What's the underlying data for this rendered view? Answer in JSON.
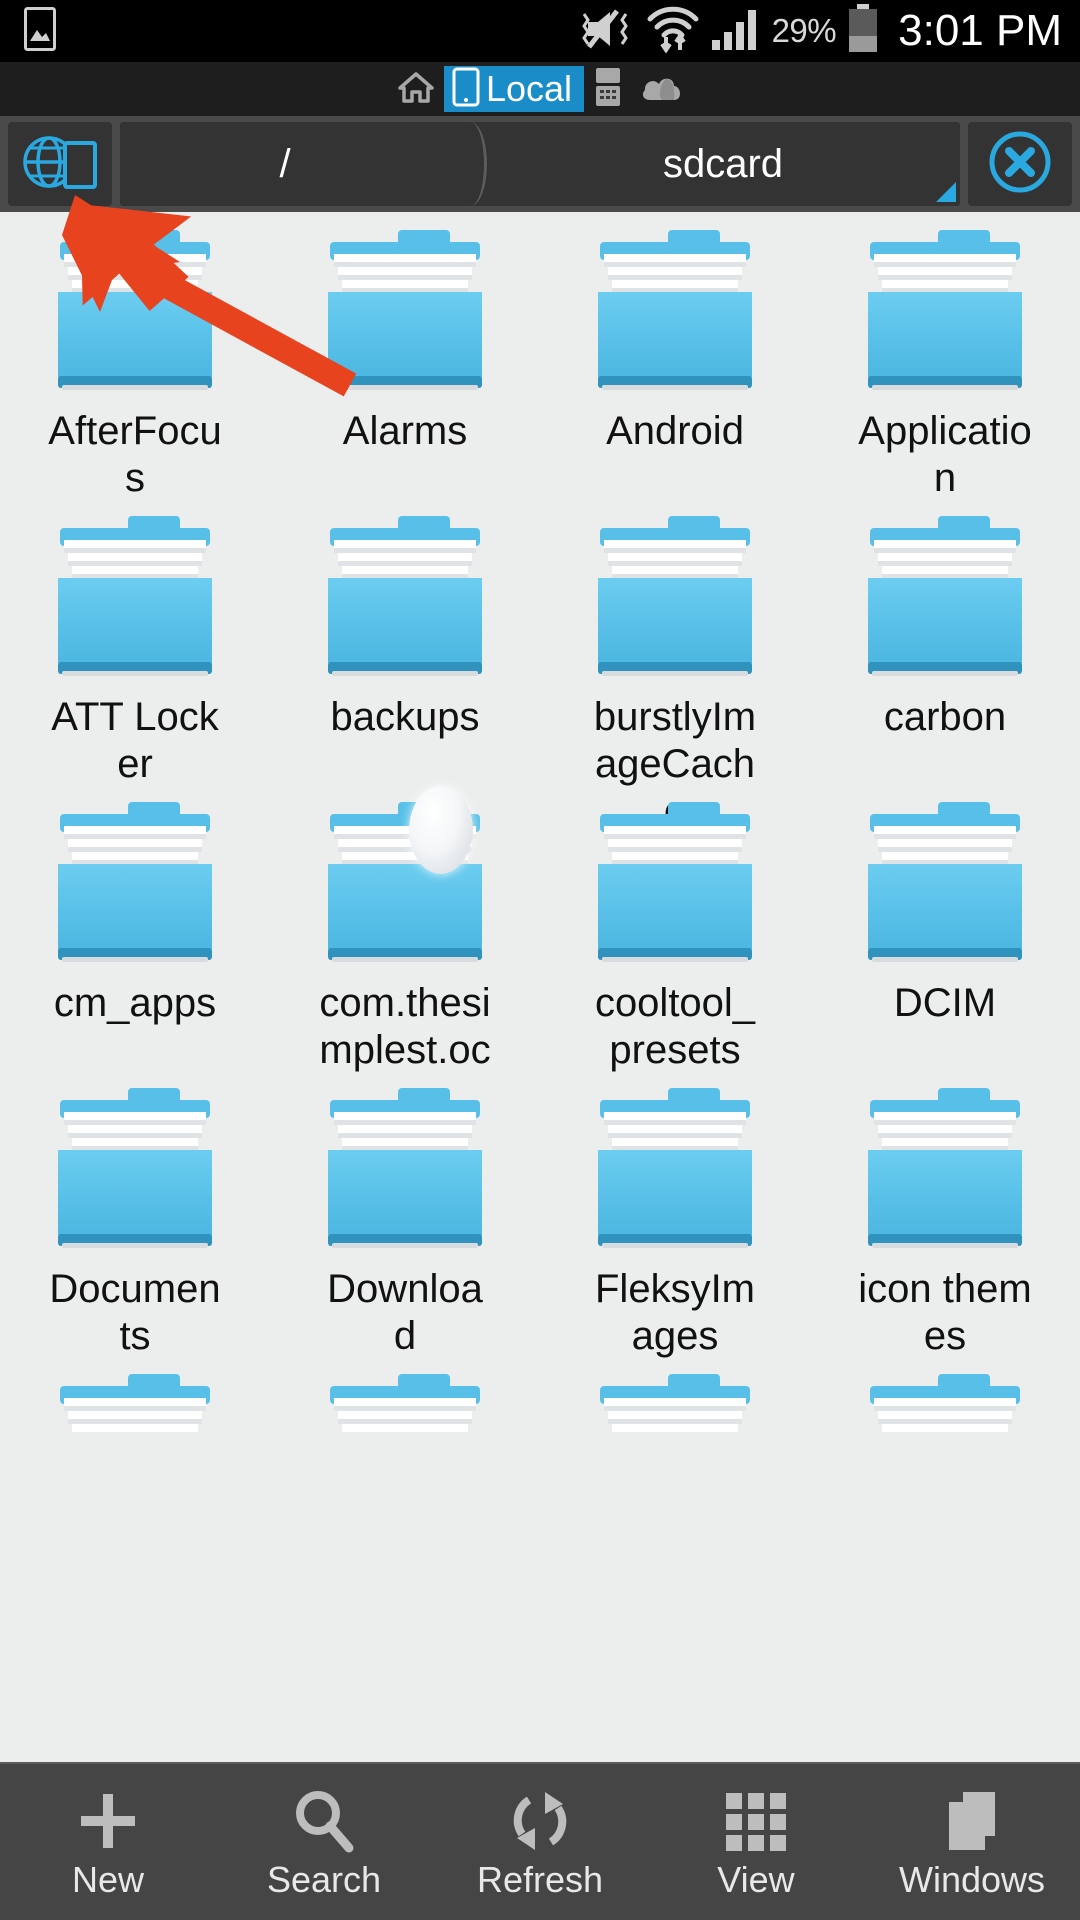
{
  "status_bar": {
    "left_icons": [
      {
        "name": "gallery-image-icon",
        "glyph": "image"
      }
    ],
    "right_icons": [
      {
        "name": "vibrate-mute-icon",
        "glyph": "mute-vibrate"
      },
      {
        "name": "wifi-data-icon",
        "glyph": "wifi"
      },
      {
        "name": "cellular-signal-icon",
        "glyph": "signal"
      }
    ],
    "battery_percent": "29%",
    "clock": "3:01 PM"
  },
  "tab_bar": {
    "tabs": [
      {
        "label": "",
        "icon": "home-icon",
        "active": false
      },
      {
        "label": "Local",
        "icon": "phone-icon",
        "active": true
      },
      {
        "label": "",
        "icon": "flip-phone-icon",
        "active": false
      },
      {
        "label": "",
        "icon": "cloud-icon",
        "active": false
      }
    ],
    "active_accent": "#1a8cc8"
  },
  "path_bar": {
    "network_button": {
      "name": "network-device-button",
      "icon": "globe-device-icon"
    },
    "crumbs": [
      {
        "label": "/",
        "name": "breadcrumb-root"
      },
      {
        "label": "sdcard",
        "name": "breadcrumb-sdcard"
      }
    ],
    "close_button": {
      "name": "close-tab-button",
      "icon": "close-circle-icon"
    },
    "accent": "#2aa8e0"
  },
  "file_grid": {
    "items": [
      {
        "name": "AfterFocus",
        "type": "folder"
      },
      {
        "name": "Alarms",
        "type": "folder"
      },
      {
        "name": "Android",
        "type": "folder"
      },
      {
        "name": "Application",
        "type": "folder"
      },
      {
        "name": "ATT Locker",
        "type": "folder"
      },
      {
        "name": "backups",
        "type": "folder"
      },
      {
        "name": "burstlyImageCache",
        "type": "folder"
      },
      {
        "name": "carbon",
        "type": "folder"
      },
      {
        "name": "cm_apps",
        "type": "folder"
      },
      {
        "name": "com.thesimplest.ocr",
        "type": "folder"
      },
      {
        "name": "cooltool_presets",
        "type": "folder"
      },
      {
        "name": "DCIM",
        "type": "folder"
      },
      {
        "name": "Documents",
        "type": "folder"
      },
      {
        "name": "Download",
        "type": "folder"
      },
      {
        "name": "FleksyImages",
        "type": "folder"
      },
      {
        "name": "icon themes",
        "type": "folder"
      },
      {
        "name": "",
        "type": "folder"
      },
      {
        "name": "",
        "type": "folder"
      },
      {
        "name": "",
        "type": "folder"
      },
      {
        "name": "",
        "type": "folder"
      }
    ],
    "folder_color": "#58c0e8",
    "background": "#eceded"
  },
  "annotation": {
    "arrow_color": "#e8431f",
    "points_to": "network-device-button"
  },
  "bottom_toolbar": {
    "items": [
      {
        "label": "New",
        "icon": "plus-icon",
        "name": "new-button"
      },
      {
        "label": "Search",
        "icon": "search-icon",
        "name": "search-button"
      },
      {
        "label": "Refresh",
        "icon": "refresh-icon",
        "name": "refresh-button"
      },
      {
        "label": "View",
        "icon": "grid-icon",
        "name": "view-button"
      },
      {
        "label": "Windows",
        "icon": "windows-stack-icon",
        "name": "windows-button"
      }
    ]
  }
}
